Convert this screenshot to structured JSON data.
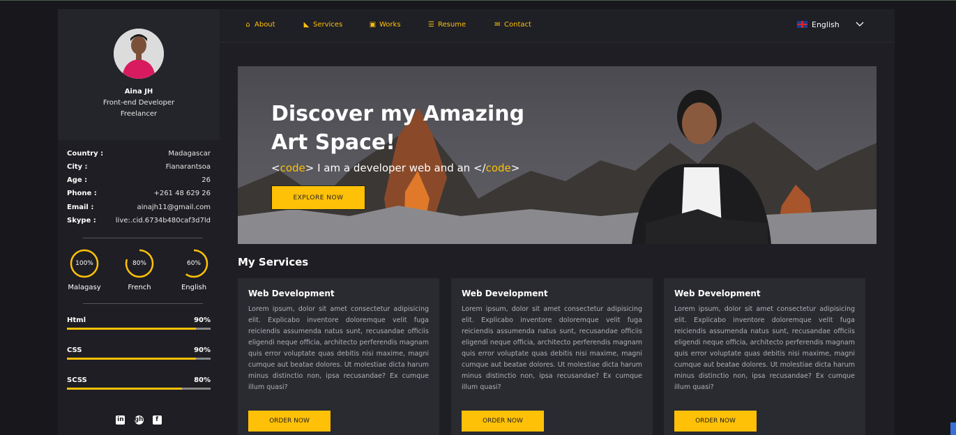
{
  "profile": {
    "name": "Aina JH",
    "title": "Front-end Developer",
    "status": "Freelancer"
  },
  "info": [
    {
      "key": "Country :",
      "value": "Madagascar"
    },
    {
      "key": "City :",
      "value": "Fianarantsoa"
    },
    {
      "key": "Age :",
      "value": "26"
    },
    {
      "key": "Phone :",
      "value": "+261 48 629 26"
    },
    {
      "key": "Email :",
      "value": "ainajh11@gmail.com"
    },
    {
      "key": "Skype :",
      "value": "live:.cid.6734b480caf3d7ld"
    }
  ],
  "languages": [
    {
      "name": "Malagasy",
      "percent_label": "100%",
      "level": 1.0
    },
    {
      "name": "French",
      "percent_label": "80%",
      "level": 0.8
    },
    {
      "name": "English",
      "percent_label": "60%",
      "level": 0.6
    }
  ],
  "skills": [
    {
      "name": "Html",
      "percent_label": "90%",
      "level": 0.9
    },
    {
      "name": "CSS",
      "percent_label": "90%",
      "level": 0.9
    },
    {
      "name": "SCSS",
      "percent_label": "80%",
      "level": 0.8
    }
  ],
  "social": {
    "linkedin": "in",
    "github": "gh",
    "facebook": "f"
  },
  "nav": {
    "items": [
      {
        "label": "About",
        "icon": "home-icon"
      },
      {
        "label": "Services",
        "icon": "services-icon"
      },
      {
        "label": "Works",
        "icon": "briefcase-icon"
      },
      {
        "label": "Resume",
        "icon": "list-icon"
      },
      {
        "label": "Contact",
        "icon": "contact-icon"
      }
    ],
    "language": "English"
  },
  "hero": {
    "title": "Discover my Amazing Art Space!",
    "sub_open": "<",
    "sub_code1": "code",
    "sub_mid": "> I am a developer web and an </",
    "sub_code2": "code",
    "sub_close": ">",
    "button": "EXPLORE NOW"
  },
  "services": {
    "heading": "My Services",
    "cards": [
      {
        "title": "Web Development",
        "text": "Lorem ipsum, dolor sit amet consectetur adipisicing elit. Explicabo inventore doloremque velit fuga reiciendis assumenda natus sunt, recusandae officiis eligendi neque officia, architecto perferendis magnam quis error voluptate quas debitis nisi maxime, magni cumque aut beatae dolores. Ut molestiae dicta harum minus distinctio non, ipsa recusandae? Ex cumque illum quasi?",
        "button": "ORDER NOW"
      },
      {
        "title": "Web Development",
        "text": "Lorem ipsum, dolor sit amet consectetur adipisicing elit. Explicabo inventore doloremque velit fuga reiciendis assumenda natus sunt, recusandae officiis eligendi neque officia, architecto perferendis magnam quis error voluptate quas debitis nisi maxime, magni cumque aut beatae dolores. Ut molestiae dicta harum minus distinctio non, ipsa recusandae? Ex cumque illum quasi?",
        "button": "ORDER NOW"
      },
      {
        "title": "Web Development",
        "text": "Lorem ipsum, dolor sit amet consectetur adipisicing elit. Explicabo inventore doloremque velit fuga reiciendis assumenda natus sunt, recusandae officiis eligendi neque officia, architecto perferendis magnam quis error voluptate quas debitis nisi maxime, magni cumque aut beatae dolores. Ut molestiae dicta harum minus distinctio non, ipsa recusandae? Ex cumque illum quasi?",
        "button": "ORDER NOW"
      }
    ]
  },
  "colors": {
    "accent": "#ffc107",
    "background": "#1e1e24",
    "card": "#2a2a31"
  }
}
